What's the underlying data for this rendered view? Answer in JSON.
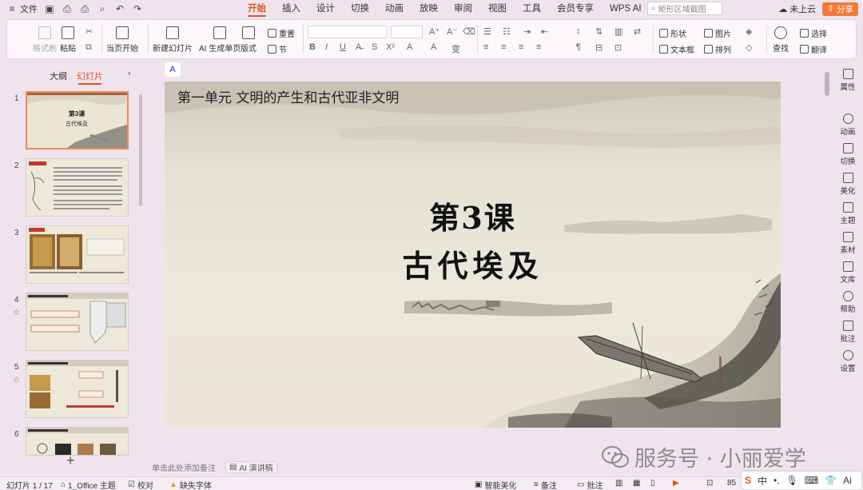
{
  "titlebar": {
    "file_menu": "文件",
    "tabs": [
      "开始",
      "插入",
      "设计",
      "切换",
      "动画",
      "放映",
      "审阅",
      "视图",
      "工具",
      "会员专享",
      "WPS AI"
    ],
    "active_tab": "开始",
    "search_placeholder": "矩形区域截图",
    "cloud": "未上云",
    "share": "分享"
  },
  "ribbon": {
    "format_painter": "格式刷",
    "paste": "粘贴",
    "from_current": "当页开始",
    "new_slide": "新建幻灯片",
    "ai_single": "AI 生成单页",
    "layout": "版式",
    "reset": "重置",
    "section": "节",
    "shape": "形状",
    "picture": "图片",
    "textbox": "文本框",
    "arrange": "排列",
    "find": "查找",
    "select": "选择",
    "translate": "翻译"
  },
  "left_panel": {
    "tab_outline": "大纲",
    "tab_slides": "幻灯片",
    "collapse": "‹",
    "slide_numbers": [
      "1",
      "2",
      "3",
      "4",
      "5",
      "6"
    ],
    "add_slide": "+"
  },
  "slide": {
    "header": "第一单元  文明的产生和古代亚非文明",
    "title_line1": "第3课",
    "title_line2": "古代埃及",
    "ai_badge": "A"
  },
  "notes": {
    "placeholder": "单击此处添加备注",
    "ai_lecture": "AI 演讲稿"
  },
  "right_sidebar": [
    "属性",
    "动画",
    "切换",
    "美化",
    "主题",
    "素材",
    "文库",
    "帮助",
    "批注",
    "设置"
  ],
  "statusbar": {
    "slide_count": "幻灯片 1 / 17",
    "theme": "1_Office 主题",
    "proofread": "校对",
    "missing_font": "缺失字体",
    "smart_beautify": "智能美化",
    "notes": "备注",
    "comments": "批注",
    "zoom": "85"
  },
  "ime": {
    "lang": "中"
  },
  "watermark": "服务号 · 小丽爱学"
}
